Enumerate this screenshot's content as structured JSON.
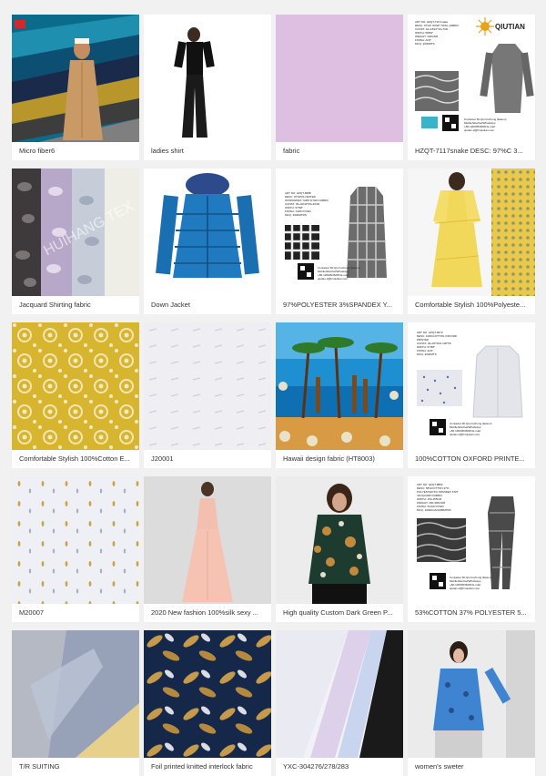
{
  "products": [
    {
      "caption": "Micro fiber6"
    },
    {
      "caption": "ladies shirt"
    },
    {
      "caption": "fabric"
    },
    {
      "caption": "HZQT-7117snake DESC: 97%C 3..."
    },
    {
      "caption": "Jacquard Shirting fabric"
    },
    {
      "caption": "Down Jacket"
    },
    {
      "caption": "97%POLYESTER 3%SPANDEX Y..."
    },
    {
      "caption": "Comfortable Stylish 100%Polyeste..."
    },
    {
      "caption": "Comfortable Stylish 100%Cotton E..."
    },
    {
      "caption": "J20001"
    },
    {
      "caption": "Hawaii design fabric (HT8003)"
    },
    {
      "caption": "100%COTTON OXFORD PRINTE..."
    },
    {
      "caption": "M20007"
    },
    {
      "caption": "2020 New fashion 100%silk sexy ..."
    },
    {
      "caption": "High quality Custom Dark Green P..."
    },
    {
      "caption": "53%COTTON 37% POLYESTER 5..."
    },
    {
      "caption": "T/R SUITING"
    },
    {
      "caption": "Foil printed knitted interlock fabric"
    },
    {
      "caption": "YXC-304276/278/283"
    },
    {
      "caption": "women's sweter"
    }
  ],
  "watermark": "HUIHANG TEX",
  "brand": "QIUTIAN",
  "spec_sheets": {
    "p4": [
      "ART NO: HZQT-7117snake",
      "DESC: 97%C 3%SP TWILL FABRIC",
      "CONST: 16+16SX*16+70D",
      "WIDTH: 58/59\"",
      "WEIGHT: 340GSM",
      "FINISH: AOP",
      "MCQ: 2000MTS"
    ],
    "p7": [
      "ART NO: HZQT-6588",
      "DESC: 97%POLYESTER",
      "3%SPANDEX YARN DYED FABRIC",
      "CONST: 45+40/40*45+40/40",
      "WIDTH: 57/58\"",
      "FINISH: YARN DYED",
      "MCQ: 3000MTRS"
    ],
    "p12": [
      "ART NO: HZQT-9973",
      "DESC: 100%COTTON OXFORD",
      "PRINTED",
      "CONST: 40+40*40/2 100*50",
      "WIDTH: 57/58\"",
      "FINISH: AOP",
      "MCQ: 2000MTS"
    ],
    "p16": [
      "ART NO: HZQT-8852",
      "DESC: 58%COTTON 37%",
      "POLYESTER 5% SPANDEX KNIT",
      "JACQUARD FABRIC",
      "WIDTH: 150-155CM",
      "WEIGHT: 290-300GSM",
      "FINISH: SOLID DYED",
      "MCQ: 1000KGS/1000MTRS"
    ]
  },
  "contact_lines": [
    "Contacter:Mr.Qiu Fuzhong (Eason)",
    "Mobile/Wechat/WhatsApp",
    "+86-13600536280 E-mail:",
    "qiutian-2@hzqiutian.com"
  ],
  "colors": {
    "page_bg": "#f1f1f1",
    "card_bg": "#ffffff",
    "caption_text": "#333333"
  }
}
